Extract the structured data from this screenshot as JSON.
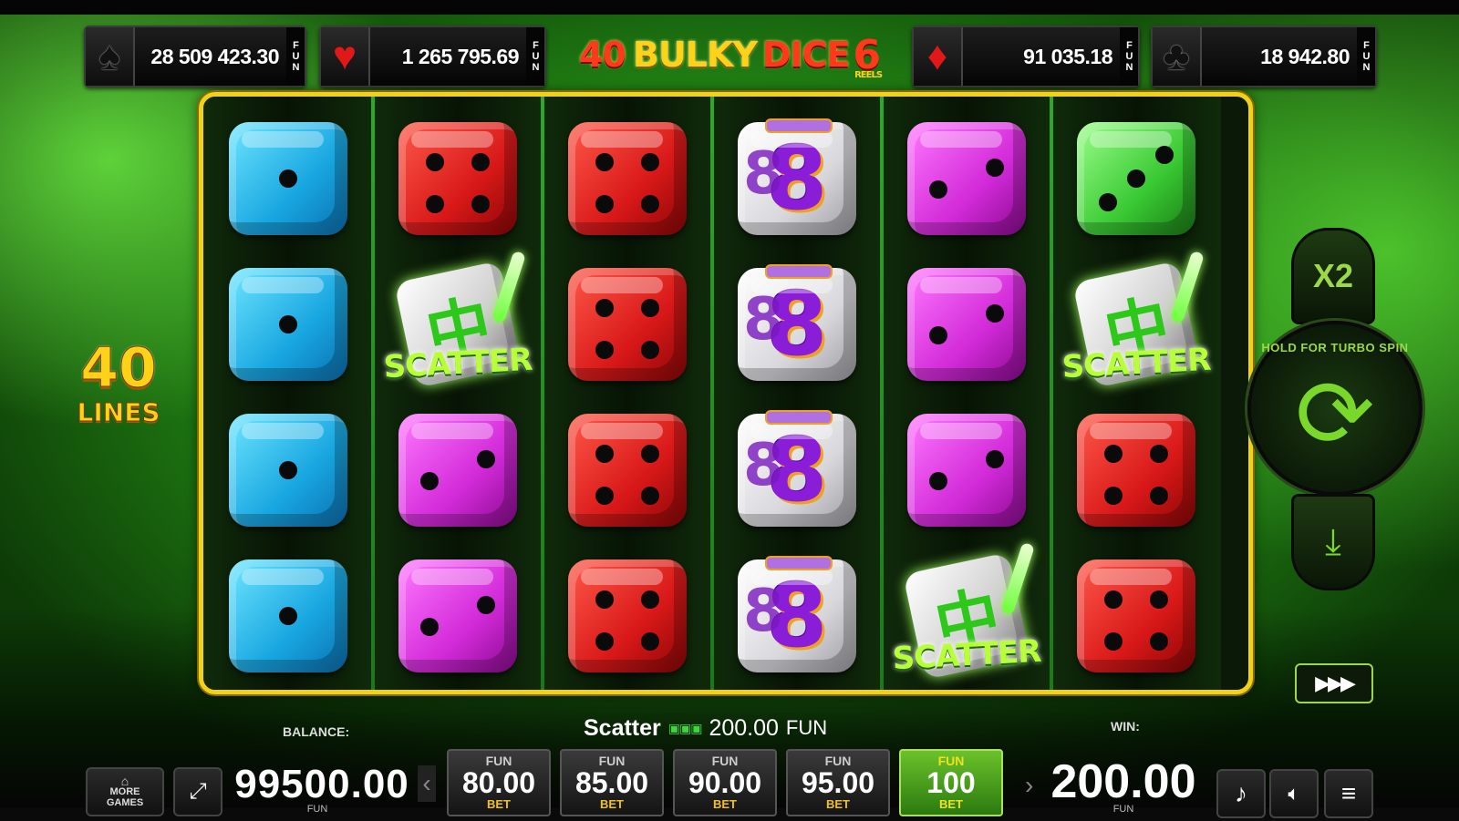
{
  "jackpots": [
    {
      "suit": "spade",
      "symbol": "♠",
      "amount": "28 509 423.30",
      "currency": "FUN"
    },
    {
      "suit": "heart",
      "symbol": "♥",
      "amount": "1 265 795.69",
      "currency": "FUN"
    },
    {
      "suit": "diamond",
      "symbol": "♦",
      "amount": "91 035.18",
      "currency": "FUN"
    },
    {
      "suit": "club",
      "symbol": "♣",
      "amount": "18 942.80",
      "currency": "FUN"
    }
  ],
  "logo": {
    "part1": "40",
    "part2": "BULKY",
    "part3": "DICE",
    "part4": "6",
    "reels": "REELS"
  },
  "lines": {
    "count": "40",
    "label": "LINES"
  },
  "scatter_label": "SCATTER",
  "reels": [
    [
      "blue1",
      "blue1",
      "blue1",
      "blue1"
    ],
    [
      "red4",
      "scatter",
      "pink2",
      "pink2"
    ],
    [
      "red4",
      "red4",
      "red4",
      "red4"
    ],
    [
      "eight",
      "eight",
      "eight",
      "eight"
    ],
    [
      "pink2",
      "pink2",
      "pink2",
      "scatter"
    ],
    [
      "green3",
      "scatter",
      "red4",
      "red4"
    ]
  ],
  "controls": {
    "multiplier": "X2",
    "spin_hint": "HOLD FOR TURBO SPIN",
    "spin_icon": "refresh-icon",
    "download_icon": "download-icon",
    "fast_forward": "▶▶▶"
  },
  "info_line": {
    "label": "Scatter",
    "win": "200.00",
    "currency": "FUN"
  },
  "balance": {
    "label": "BALANCE:",
    "value": "99500.00",
    "currency": "FUN"
  },
  "more_games": {
    "line1": "MORE",
    "line2": "GAMES"
  },
  "bets": [
    {
      "top": "FUN",
      "value": "80.00",
      "bottom": "BET",
      "active": false
    },
    {
      "top": "FUN",
      "value": "85.00",
      "bottom": "BET",
      "active": false
    },
    {
      "top": "FUN",
      "value": "90.00",
      "bottom": "BET",
      "active": false
    },
    {
      "top": "FUN",
      "value": "95.00",
      "bottom": "BET",
      "active": false
    },
    {
      "top": "FUN",
      "value": "100",
      "bottom": "BET",
      "active": true
    }
  ],
  "win": {
    "label": "WIN:",
    "value": "200.00",
    "currency": "FUN"
  },
  "colors": {
    "frame": "#f0d21a",
    "accent_green": "#7ad82a"
  }
}
